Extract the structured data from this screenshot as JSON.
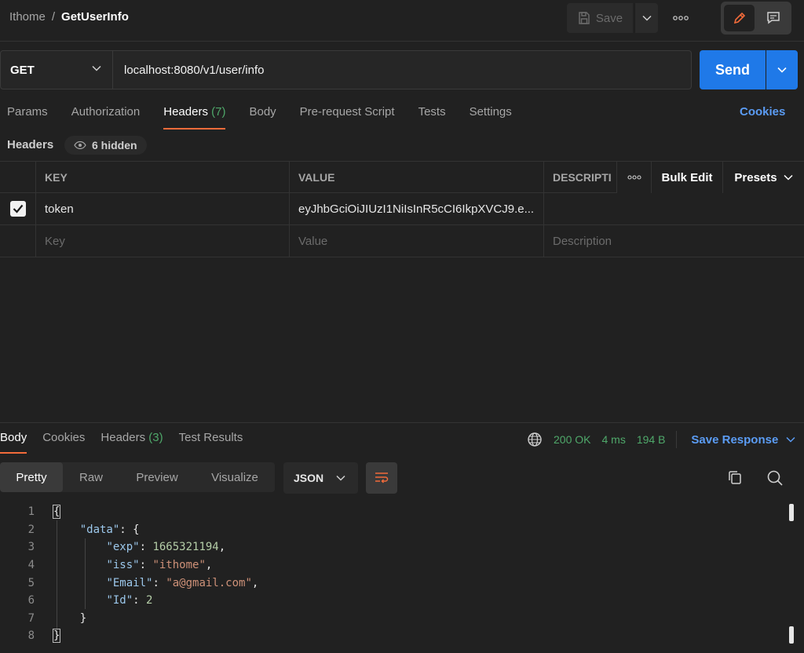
{
  "breadcrumb": {
    "collection": "Ithome",
    "separator": "/",
    "request": "GetUserInfo"
  },
  "toolbar": {
    "save_label": "Save"
  },
  "request": {
    "method": "GET",
    "url": "localhost:8080/v1/user/info",
    "send_label": "Send"
  },
  "request_tabs": {
    "params": "Params",
    "authorization": "Authorization",
    "headers": "Headers",
    "headers_count": "(7)",
    "body": "Body",
    "pre_request": "Pre-request Script",
    "tests": "Tests",
    "settings": "Settings",
    "cookies": "Cookies"
  },
  "headers_section": {
    "label": "Headers",
    "hidden": "6 hidden"
  },
  "headers_table": {
    "columns": {
      "key": "KEY",
      "value": "VALUE",
      "description": "DESCRIPTI"
    },
    "bulk_edit": "Bulk Edit",
    "presets": "Presets",
    "rows": [
      {
        "key": "token",
        "value": "eyJhbGciOiJIUzI1NiIsInR5cCI6IkpXVCJ9.e...",
        "checked": true
      }
    ],
    "placeholder": {
      "key": "Key",
      "value": "Value",
      "description": "Description"
    }
  },
  "response": {
    "tabs": {
      "body": "Body",
      "cookies": "Cookies",
      "headers": "Headers",
      "headers_count": "(3)",
      "test_results": "Test Results"
    },
    "status": "200 OK",
    "time": "4 ms",
    "size": "194 B",
    "save_response": "Save Response",
    "views": {
      "pretty": "Pretty",
      "raw": "Raw",
      "preview": "Preview",
      "visualize": "Visualize"
    },
    "format": "JSON"
  },
  "code": {
    "line_numbers": [
      "1",
      "2",
      "3",
      "4",
      "5",
      "6",
      "7",
      "8"
    ],
    "open_brace": "{",
    "data_key": "\"data\"",
    "colon_brace": ": {",
    "exp_key": "\"exp\"",
    "exp_value": "1665321194",
    "iss_key": "\"iss\"",
    "iss_value": "\"ithome\"",
    "email_key": "\"Email\"",
    "email_value": "\"a@gmail.com\"",
    "id_key": "\"Id\"",
    "id_value": "2",
    "inner_close": "}",
    "close_brace": "}"
  },
  "colors": {
    "accent": "#f26b3a",
    "send": "#1f79e8",
    "link": "#5b9cf4",
    "success": "#4fa86a"
  }
}
